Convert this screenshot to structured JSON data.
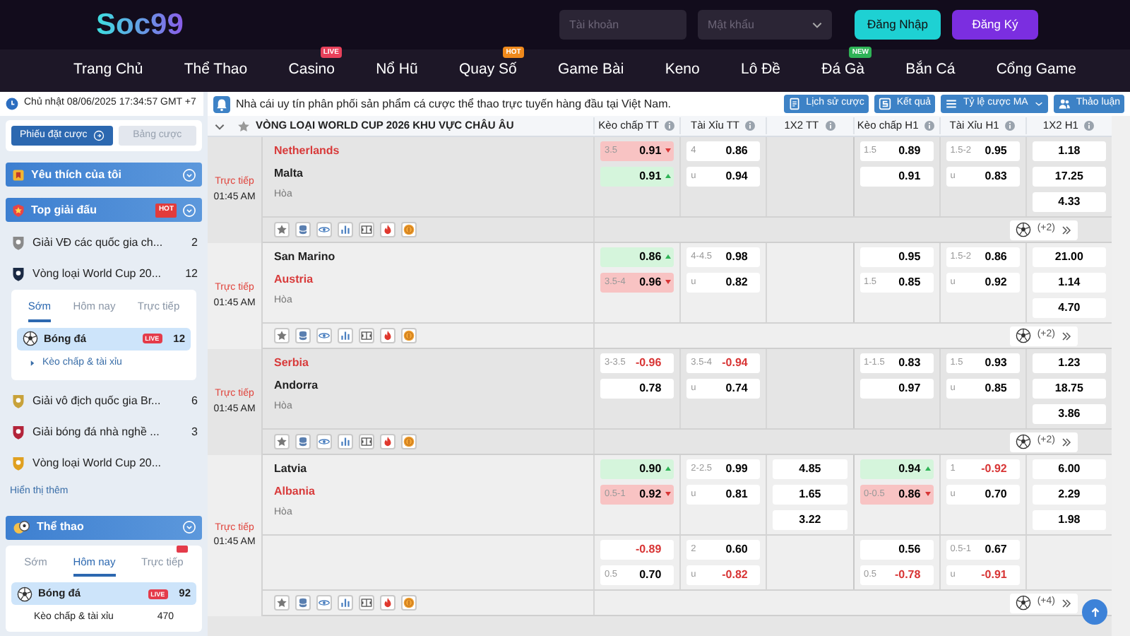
{
  "header": {
    "logo": "Soc99",
    "username": {
      "placeholder": "Tài khoản"
    },
    "password": {
      "placeholder": "Mật khẩu"
    },
    "login": "Đăng Nhập",
    "register": "Đăng Ký"
  },
  "nav": [
    {
      "label": "Trang Chủ"
    },
    {
      "label": "Thể Thao"
    },
    {
      "label": "Casino",
      "badge": {
        "text": "LIVE",
        "color": "#e8415b"
      }
    },
    {
      "label": "Nổ Hũ"
    },
    {
      "label": "Quay Số",
      "badge": {
        "text": "HOT",
        "color": "#f08a1c"
      }
    },
    {
      "label": "Game Bài"
    },
    {
      "label": "Keno"
    },
    {
      "label": "Lô Đề"
    },
    {
      "label": "Đá Gà",
      "badge": {
        "text": "NEW",
        "color": "#2fb457"
      }
    },
    {
      "label": "Bắn Cá"
    },
    {
      "label": "Cổng Game"
    }
  ],
  "clock": "Chủ nhật 08/06/2025 17:34:57 GMT +7",
  "notice": "Nhà cái uy tín phân phối sản phẩm cá cược thể thao trực tuyến hàng đầu tại Việt Nam.",
  "tools": [
    {
      "label": "Lịch sử cược",
      "kind": "history"
    },
    {
      "label": "Kết quả",
      "kind": "results"
    },
    {
      "label": "Tỷ lệ cược MA",
      "kind": "odds"
    },
    {
      "label": "Thảo luận",
      "kind": "chat"
    }
  ],
  "sidebar": {
    "bet_tabs": [
      {
        "label": "Phiếu đặt cược",
        "selected": true
      },
      {
        "label": "Bảng cược",
        "selected": false
      }
    ],
    "favorites": {
      "title": "Yêu thích của tôi"
    },
    "top_leagues": {
      "title": "Top giải đấu",
      "badge": "HOT",
      "items": [
        {
          "name": "Giải VĐ các quốc gia ch...",
          "count": "2"
        },
        {
          "name": "Vòng loại World Cup 20...",
          "count": "12",
          "tabs": [
            {
              "label": "Sớm",
              "selected": true
            },
            {
              "label": "Hôm nay",
              "selected": false
            },
            {
              "label": "Trực tiếp",
              "selected": false
            }
          ],
          "rows": [
            {
              "kind": "sport",
              "name": "Bóng đá",
              "badge": "LIVE",
              "count": "12"
            },
            {
              "kind": "market",
              "name": "Kèo chấp & tài xỉu"
            }
          ]
        },
        {
          "name": "Giải vô địch quốc gia Br...",
          "count": "6"
        },
        {
          "name": "Giải bóng đá nhà nghề ...",
          "count": "3"
        },
        {
          "name": "Vòng loại World Cup 20..."
        }
      ]
    },
    "show_more": "Hiển thị thêm",
    "sports": {
      "title": "Thể thao",
      "tabs": [
        {
          "label": "Sớm",
          "selected": false
        },
        {
          "label": "Hôm nay",
          "selected": true
        },
        {
          "label": "Trực tiếp",
          "selected": false,
          "live_badge": true
        }
      ],
      "rows": [
        {
          "kind": "sport",
          "name": "Bóng đá",
          "badge": "LIVE",
          "count": "92"
        },
        {
          "kind": "plain",
          "name": "Kèo chấp & tài xỉu",
          "count": "470"
        }
      ]
    }
  },
  "table": {
    "league": "VÒNG LOẠI WORLD CUP 2026 KHU VỰC CHÂU ÂU",
    "columns": [
      "Kèo chấp TT",
      "Tài Xỉu TT",
      "1X2 TT",
      "Kèo chấp H1",
      "Tài Xỉu H1",
      "1X2 H1"
    ],
    "matches": [
      {
        "status": "Trực tiếp",
        "time": "01:45 AM",
        "teams": [
          {
            "name": "Netherlands",
            "favorite": true
          },
          {
            "name": "Malta",
            "favorite": false
          }
        ],
        "draw": "Hòa",
        "more": "(+2)",
        "lines": [
          {
            "cells": [
              [
                {
                  "hdp": "3.5",
                  "odd": "0.91",
                  "kind": "falling",
                  "negative": false
                },
                {
                  "odd": "0.91",
                  "kind": "rising",
                  "negative": false
                }
              ],
              [
                {
                  "hdp": "4",
                  "odd": "0.86",
                  "kind": "plain",
                  "negative": false
                },
                {
                  "hdp": "u",
                  "odd": "0.94",
                  "kind": "plain",
                  "negative": false
                }
              ],
              [],
              [
                {
                  "hdp": "1.5",
                  "odd": "0.89",
                  "kind": "plain",
                  "negative": false
                },
                {
                  "odd": "0.91",
                  "kind": "plain",
                  "negative": false
                }
              ],
              [
                {
                  "hdp": "1.5-2",
                  "odd": "0.95",
                  "kind": "plain",
                  "negative": false
                },
                {
                  "hdp": "u",
                  "odd": "0.83",
                  "kind": "plain",
                  "negative": false
                }
              ],
              [
                {
                  "odd": "1.18",
                  "kind": "plain",
                  "negative": false
                },
                {
                  "odd": "17.25",
                  "kind": "plain",
                  "negative": false
                },
                {
                  "odd": "4.33",
                  "kind": "plain",
                  "negative": false
                }
              ]
            ]
          }
        ]
      },
      {
        "status": "Trực tiếp",
        "time": "01:45 AM",
        "teams": [
          {
            "name": "San Marino",
            "favorite": false
          },
          {
            "name": "Austria",
            "favorite": true
          }
        ],
        "draw": "Hòa",
        "more": "(+2)",
        "lines": [
          {
            "cells": [
              [
                {
                  "odd": "0.86",
                  "kind": "rising",
                  "negative": false
                },
                {
                  "hdp": "3.5-4",
                  "odd": "0.96",
                  "kind": "falling",
                  "negative": false
                }
              ],
              [
                {
                  "hdp": "4-4.5",
                  "odd": "0.98",
                  "kind": "plain",
                  "negative": false
                },
                {
                  "hdp": "u",
                  "odd": "0.82",
                  "kind": "plain",
                  "negative": false
                }
              ],
              [],
              [
                {
                  "odd": "0.95",
                  "kind": "plain",
                  "negative": false
                },
                {
                  "hdp": "1.5",
                  "odd": "0.85",
                  "kind": "plain",
                  "negative": false
                }
              ],
              [
                {
                  "hdp": "1.5-2",
                  "odd": "0.86",
                  "kind": "plain",
                  "negative": false
                },
                {
                  "hdp": "u",
                  "odd": "0.92",
                  "kind": "plain",
                  "negative": false
                }
              ],
              [
                {
                  "odd": "21.00",
                  "kind": "plain",
                  "negative": false
                },
                {
                  "odd": "1.14",
                  "kind": "plain",
                  "negative": false
                },
                {
                  "odd": "4.70",
                  "kind": "plain",
                  "negative": false
                }
              ]
            ]
          }
        ]
      },
      {
        "status": "Trực tiếp",
        "time": "01:45 AM",
        "teams": [
          {
            "name": "Serbia",
            "favorite": true
          },
          {
            "name": "Andorra",
            "favorite": false
          }
        ],
        "draw": "Hòa",
        "more": "(+2)",
        "lines": [
          {
            "cells": [
              [
                {
                  "hdp": "3-3.5",
                  "odd": "-0.96",
                  "kind": "plain",
                  "negative": true
                },
                {
                  "odd": "0.78",
                  "kind": "plain",
                  "negative": false
                }
              ],
              [
                {
                  "hdp": "3.5-4",
                  "odd": "-0.94",
                  "kind": "plain",
                  "negative": true
                },
                {
                  "hdp": "u",
                  "odd": "0.74",
                  "kind": "plain",
                  "negative": false
                }
              ],
              [],
              [
                {
                  "hdp": "1-1.5",
                  "odd": "0.83",
                  "kind": "plain",
                  "negative": false
                },
                {
                  "odd": "0.97",
                  "kind": "plain",
                  "negative": false
                }
              ],
              [
                {
                  "hdp": "1.5",
                  "odd": "0.93",
                  "kind": "plain",
                  "negative": false
                },
                {
                  "hdp": "u",
                  "odd": "0.85",
                  "kind": "plain",
                  "negative": false
                }
              ],
              [
                {
                  "odd": "1.23",
                  "kind": "plain",
                  "negative": false
                },
                {
                  "odd": "18.75",
                  "kind": "plain",
                  "negative": false
                },
                {
                  "odd": "3.86",
                  "kind": "plain",
                  "negative": false
                }
              ]
            ]
          }
        ]
      },
      {
        "status": "Trực tiếp",
        "time": "01:45 AM",
        "teams": [
          {
            "name": "Latvia",
            "favorite": false
          },
          {
            "name": "Albania",
            "favorite": true
          }
        ],
        "draw": "Hòa",
        "more": "(+4)",
        "lines": [
          {
            "cells": [
              [
                {
                  "odd": "0.90",
                  "kind": "rising",
                  "negative": false
                },
                {
                  "hdp": "0.5-1",
                  "odd": "0.92",
                  "kind": "falling",
                  "negative": false
                }
              ],
              [
                {
                  "hdp": "2-2.5",
                  "odd": "0.99",
                  "kind": "plain",
                  "negative": false
                },
                {
                  "hdp": "u",
                  "odd": "0.81",
                  "kind": "plain",
                  "negative": false
                }
              ],
              [
                {
                  "odd": "4.85",
                  "kind": "plain",
                  "negative": false
                },
                {
                  "odd": "1.65",
                  "kind": "plain",
                  "negative": false
                },
                {
                  "odd": "3.22",
                  "kind": "plain",
                  "negative": false
                }
              ],
              [
                {
                  "odd": "0.94",
                  "kind": "rising",
                  "negative": false
                },
                {
                  "hdp": "0-0.5",
                  "odd": "0.86",
                  "kind": "falling",
                  "negative": false
                }
              ],
              [
                {
                  "hdp": "1",
                  "odd": "-0.92",
                  "kind": "plain",
                  "negative": true
                },
                {
                  "hdp": "u",
                  "odd": "0.70",
                  "kind": "plain",
                  "negative": false
                }
              ],
              [
                {
                  "odd": "6.00",
                  "kind": "plain",
                  "negative": false
                },
                {
                  "odd": "2.29",
                  "kind": "plain",
                  "negative": false
                },
                {
                  "odd": "1.98",
                  "kind": "plain",
                  "negative": false
                }
              ]
            ]
          },
          {
            "cells": [
              [
                {
                  "odd": "-0.89",
                  "kind": "plain",
                  "negative": true
                },
                {
                  "hdp": "0.5",
                  "odd": "0.70",
                  "kind": "plain",
                  "negative": false
                }
              ],
              [
                {
                  "hdp": "2",
                  "odd": "0.60",
                  "kind": "plain",
                  "negative": false
                },
                {
                  "hdp": "u",
                  "odd": "-0.82",
                  "kind": "plain",
                  "negative": true
                }
              ],
              [],
              [
                {
                  "odd": "0.56",
                  "kind": "plain",
                  "negative": false
                },
                {
                  "hdp": "0.5",
                  "odd": "-0.78",
                  "kind": "plain",
                  "negative": true
                }
              ],
              [
                {
                  "hdp": "0.5-1",
                  "odd": "0.67",
                  "kind": "plain",
                  "negative": false
                },
                {
                  "hdp": "u",
                  "odd": "-0.91",
                  "kind": "plain",
                  "negative": true
                }
              ],
              []
            ]
          }
        ]
      }
    ]
  }
}
